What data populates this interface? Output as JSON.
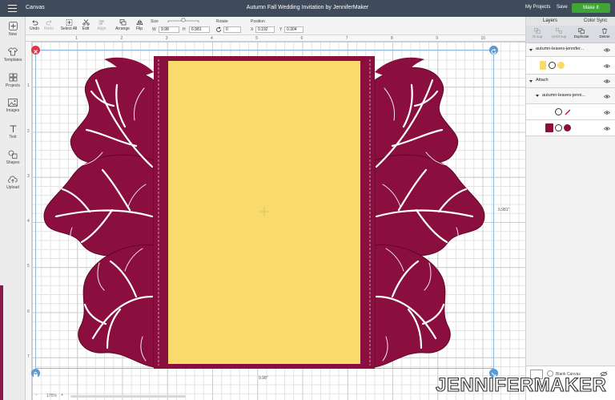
{
  "topbar": {
    "app_name": "Canvas",
    "doc_title": "Autumn Fall Wedding Invitation by JenniferMaker",
    "my_projects": "My Projects",
    "save": "Save",
    "make_it": "Make It"
  },
  "left_rail": {
    "items": [
      {
        "label": "New",
        "icon": "plus-icon"
      },
      {
        "label": "Templates",
        "icon": "shirt-icon"
      },
      {
        "label": "Projects",
        "icon": "grid-icon"
      },
      {
        "label": "Images",
        "icon": "image-icon"
      },
      {
        "label": "Text",
        "icon": "text-icon"
      },
      {
        "label": "Shapes",
        "icon": "shapes-icon"
      },
      {
        "label": "Upload",
        "icon": "upload-icon"
      }
    ]
  },
  "toolbar": {
    "undo": "Undo",
    "redo": "Redo",
    "select_all": "Select All",
    "edit": "Edit",
    "align": "Align",
    "arrange": "Arrange",
    "flip": "Flip",
    "size_label": "Size",
    "w_label": "W",
    "w_value": "9.98",
    "h_label": "H",
    "h_value": "6.981",
    "rotate_label": "Rotate",
    "rotate_value": "0",
    "position_label": "Position",
    "x_label": "X",
    "x_value": "0.192",
    "y_label": "Y",
    "y_value": "0.304"
  },
  "canvas": {
    "ruler_top": [
      "1",
      "2",
      "3",
      "4",
      "5",
      "6",
      "7",
      "8",
      "9",
      "10"
    ],
    "ruler_left": [
      "1",
      "2",
      "3",
      "4",
      "5",
      "6",
      "7"
    ],
    "width_label": "9.98\"",
    "height_label": "6.981\"",
    "zoom": "175%",
    "colors": {
      "leaf": "#8b0f3e",
      "leaf_outline": "#5c0727",
      "card": "#f8db6b",
      "frame": "#8b0f3e"
    }
  },
  "right_panel": {
    "tabs": [
      "Layers",
      "Color Sync"
    ],
    "actions": [
      "Group",
      "UnGroup",
      "Duplicate",
      "Delete"
    ],
    "layers": [
      {
        "name": "autumn-leaves-jennifer...",
        "kind": "group"
      },
      {
        "name": "Attach",
        "kind": "group"
      },
      {
        "name": "autumn-leaves-jenni...",
        "kind": "group"
      }
    ],
    "swatch_colors": {
      "yellow": "#f8db6b",
      "red": "#c8102e",
      "magenta": "#8b0f3e"
    },
    "blank_canvas": "Blank Canvas"
  },
  "watermark": {
    "text": "JENNIFERMAKER",
    "dot_color": "#8b0f3e"
  }
}
